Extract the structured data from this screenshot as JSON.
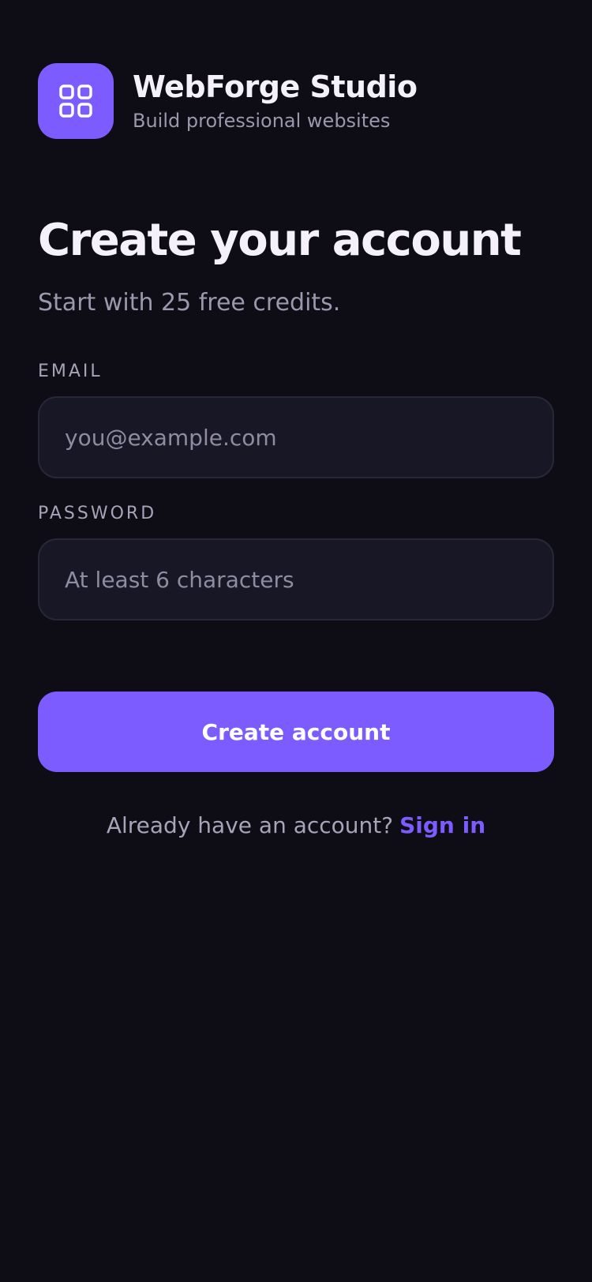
{
  "brand": {
    "icon": "grid-icon",
    "name": "WebForge Studio",
    "tagline": "Build professional websites"
  },
  "form": {
    "title": "Create your account",
    "subtitle": "Start with 25 free credits.",
    "email": {
      "label": "EMAIL",
      "placeholder": "you@example.com",
      "value": ""
    },
    "password": {
      "label": "PASSWORD",
      "placeholder": "At least 6 characters",
      "value": ""
    },
    "submit_label": "Create account"
  },
  "footer": {
    "prompt": "Already have an account?",
    "link_label": "Sign in"
  },
  "colors": {
    "background": "#0e0d15",
    "accent": "#7c5cff",
    "input_background": "#181725",
    "muted_text": "#9b97ad"
  }
}
